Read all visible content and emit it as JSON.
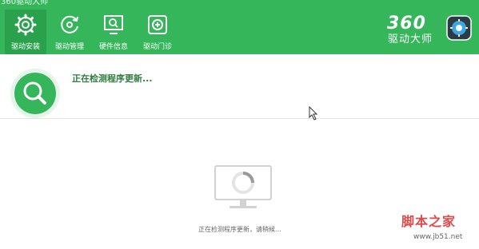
{
  "app": {
    "title": "360驱动大师"
  },
  "nav": [
    {
      "label": "驱动安装",
      "icon": "gear-icon",
      "active": true
    },
    {
      "label": "驱动管理",
      "icon": "refresh-icon",
      "active": false
    },
    {
      "label": "硬件信息",
      "icon": "monitor-icon",
      "active": false
    },
    {
      "label": "驱动门诊",
      "icon": "clinic-icon",
      "active": false
    }
  ],
  "logo": {
    "top": "360",
    "bottom": "驱动大师"
  },
  "scan": {
    "title": "正在检测程序更新...",
    "subtitle": "正在检测程序更新，请稍候..."
  },
  "watermark": {
    "text": "脚本之家",
    "url": "www.jb51.net"
  },
  "colors": {
    "header_green": "#35b65a",
    "active_tab": "#2aa24d",
    "status_text": "#2f7d3f"
  }
}
